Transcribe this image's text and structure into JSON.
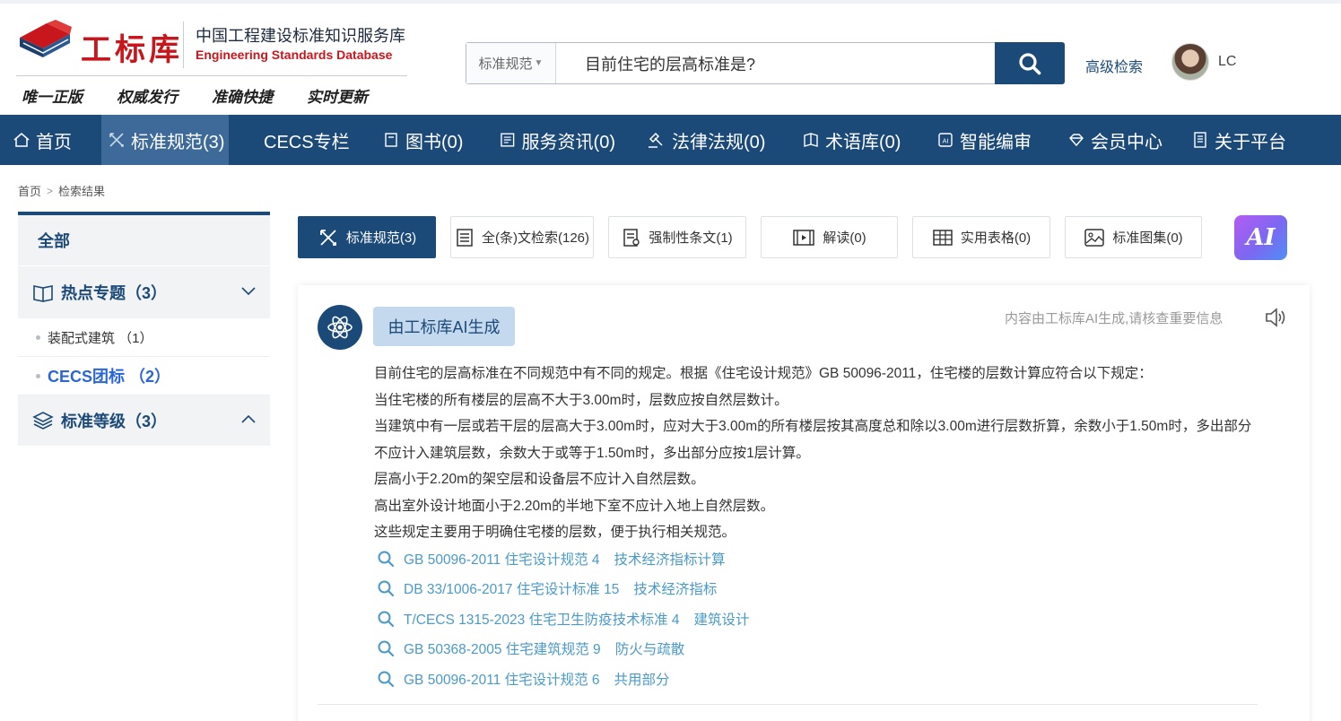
{
  "header": {
    "logo_name": "工标库",
    "logo_cn": "中国工程建设标准知识服务库",
    "logo_en": "Engineering Standards Database",
    "slogans": [
      "唯一正版",
      "权威发行",
      "准确快捷",
      "实时更新"
    ],
    "search": {
      "type_label": "标准规范",
      "query": "目前住宅的层高标准是?"
    },
    "advanced_search": "高级检索",
    "user_name": "LC"
  },
  "nav": [
    {
      "label": "首页",
      "icon": "home-icon"
    },
    {
      "label": "标准规范(3)",
      "icon": "tools-icon",
      "active": true
    },
    {
      "label": "CECS专栏",
      "icon": "ruler-icon"
    },
    {
      "label": "图书(0)",
      "icon": "book-icon"
    },
    {
      "label": "服务资讯(0)",
      "icon": "news-icon"
    },
    {
      "label": "法律法规(0)",
      "icon": "gavel-icon"
    },
    {
      "label": "术语库(0)",
      "icon": "glossary-icon"
    },
    {
      "label": "智能编审",
      "icon": "ai-chip-icon"
    },
    {
      "label": "会员中心",
      "icon": "diamond-icon"
    },
    {
      "label": "关于平台",
      "icon": "document-icon"
    }
  ],
  "breadcrumb": [
    "首页",
    "检索结果"
  ],
  "sidebar": {
    "all": "全部",
    "groups": [
      {
        "label": "热点专题（3）",
        "icon": "open-book-icon",
        "chevron": "chevron-down-icon",
        "items": [
          {
            "label": "装配式建筑 （1）"
          },
          {
            "label": "CECS团标 （2）",
            "active": true
          }
        ]
      },
      {
        "label": "标准等级（3）",
        "icon": "layers-icon",
        "chevron": "chevron-up-icon",
        "items": []
      }
    ]
  },
  "tabs": [
    {
      "label": "标准规范(3)",
      "icon": "tools-icon",
      "active": true
    },
    {
      "label": "全(条)文检索(126)",
      "icon": "fulltext-icon"
    },
    {
      "label": "强制性条文(1)",
      "icon": "mandatory-icon"
    },
    {
      "label": "解读(0)",
      "icon": "video-icon"
    },
    {
      "label": "实用表格(0)",
      "icon": "table-icon"
    },
    {
      "label": "标准图集(0)",
      "icon": "image-icon"
    }
  ],
  "ai_badge": "AI",
  "ai_card": {
    "tag": "由工标库AI生成",
    "disclaimer": "内容由工标库AI生成,请核查重要信息",
    "answer": [
      "目前住宅的层高标准在不同规范中有不同的规定。根据《住宅设计规范》GB 50096-2011，住宅楼的层数计算应符合以下规定：",
      "当住宅楼的所有楼层的层高不大于3.00m时，层数应按自然层数计。",
      "当建筑中有一层或若干层的层高大于3.00m时，应对大于3.00m的所有楼层按其高度总和除以3.00m进行层数折算，余数小于1.50m时，多出部分不应计入建筑层数，余数大于或等于1.50m时，多出部分应按1层计算。",
      "层高小于2.20m的架空层和设备层不应计入自然层数。",
      "高出室外设计地面小于2.20m的半地下室不应计入地上自然层数。",
      "这些规定主要用于明确住宅楼的层数，便于执行相关规范。"
    ],
    "references": [
      {
        "doc": "GB 50096-2011 住宅设计规范 4",
        "section": "技术经济指标计算"
      },
      {
        "doc": "DB 33/1006-2017 住宅设计标准 15",
        "section": "技术经济指标"
      },
      {
        "doc": "T/CECS 1315-2023 住宅卫生防疫技术标准 4",
        "section": "建筑设计"
      },
      {
        "doc": "GB 50368-2005 住宅建筑规范 9",
        "section": "防火与疏散"
      },
      {
        "doc": "GB 50096-2011 住宅设计规范 6",
        "section": "共用部分"
      }
    ]
  },
  "colors": {
    "primary": "#1c4a78",
    "nav_active": "#3d6a98",
    "brand_red": "#c8161d",
    "link": "#4a9ac8",
    "sidebar_active": "#2a66d6"
  }
}
